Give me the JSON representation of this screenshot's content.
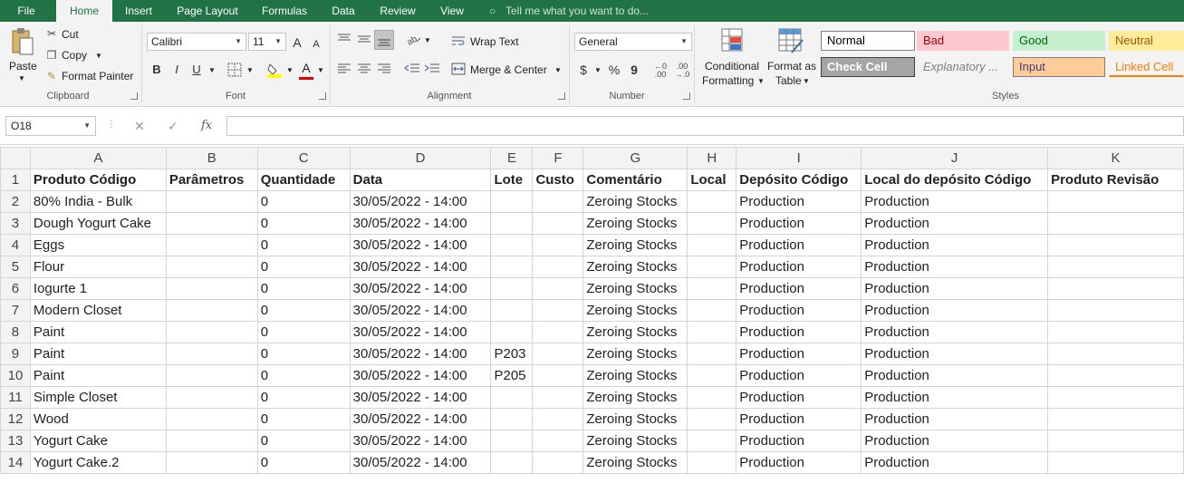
{
  "menu": {
    "tabs": [
      "File",
      "Home",
      "Insert",
      "Page Layout",
      "Formulas",
      "Data",
      "Review",
      "View"
    ],
    "active_tab": "Home",
    "tell_me": "Tell me what you want to do..."
  },
  "ribbon": {
    "clipboard": {
      "paste": "Paste",
      "cut": "Cut",
      "copy": "Copy",
      "format_painter": "Format Painter",
      "label": "Clipboard"
    },
    "font": {
      "name": "Calibri",
      "size": "11",
      "bold": "B",
      "italic": "I",
      "underline": "U",
      "grow": "A",
      "shrink": "A",
      "font_color": "A",
      "label": "Font"
    },
    "alignment": {
      "wrap_text": "Wrap Text",
      "merge_center": "Merge & Center",
      "label": "Alignment"
    },
    "number": {
      "format": "General",
      "currency": "$",
      "percent": "%",
      "comma": "9",
      "label": "Number"
    },
    "styles_buttons": {
      "conditional_line1": "Conditional",
      "conditional_line2": "Formatting",
      "format_table_line1": "Format as",
      "format_table_line2": "Table"
    },
    "styles": {
      "label": "Styles",
      "cells": [
        {
          "name": "Normal",
          "bg": "#ffffff",
          "color": "#000000",
          "border": "#7f7f7f"
        },
        {
          "name": "Bad",
          "bg": "#ffc7ce",
          "color": "#9c0006",
          "border": "#ffc7ce"
        },
        {
          "name": "Good",
          "bg": "#c6efce",
          "color": "#006100",
          "border": "#c6efce"
        },
        {
          "name": "Neutral",
          "bg": "#ffeb9c",
          "color": "#9c5700",
          "border": "#ffeb9c"
        },
        {
          "name": "Check Cell",
          "bg": "#a5a5a5",
          "color": "#ffffff",
          "border": "#3f3f3f"
        },
        {
          "name": "Explanatory ...",
          "bg": "#f3f3f3",
          "color": "#7f7f7f",
          "border": "#f3f3f3"
        },
        {
          "name": "Input",
          "bg": "#ffcc99",
          "color": "#3f3f76",
          "border": "#7f7f7f"
        },
        {
          "name": "Linked Cell",
          "bg": "#f3f3f3",
          "color": "#fa7d00",
          "border": "#f3f3f3"
        }
      ]
    }
  },
  "formula_bar": {
    "name_box": "O18",
    "fx": "fx",
    "cancel": "✕",
    "enter": "✓",
    "value": ""
  },
  "sheet": {
    "columns": [
      "A",
      "B",
      "C",
      "D",
      "E",
      "F",
      "G",
      "H",
      "I",
      "J",
      "K"
    ],
    "rows": [
      {
        "n": "1",
        "cells": [
          "Produto Código",
          "Parâmetros",
          "Quantidade",
          "Data",
          "Lote",
          "Custo",
          "Comentário",
          "Local",
          "Depósito Código",
          "Local do depósito Código",
          "Produto Revisão"
        ]
      },
      {
        "n": "2",
        "cells": [
          "80% India - Bulk",
          "",
          "0",
          "30/05/2022 - 14:00",
          "",
          "",
          "Zeroing Stocks",
          "",
          "Production",
          "Production",
          ""
        ]
      },
      {
        "n": "3",
        "cells": [
          "Dough Yogurt Cake",
          "",
          "0",
          "30/05/2022 - 14:00",
          "",
          "",
          "Zeroing Stocks",
          "",
          "Production",
          "Production",
          ""
        ]
      },
      {
        "n": "4",
        "cells": [
          "Eggs",
          "",
          "0",
          "30/05/2022 - 14:00",
          "",
          "",
          "Zeroing Stocks",
          "",
          "Production",
          "Production",
          ""
        ]
      },
      {
        "n": "5",
        "cells": [
          "Flour",
          "",
          "0",
          "30/05/2022 - 14:00",
          "",
          "",
          "Zeroing Stocks",
          "",
          "Production",
          "Production",
          ""
        ]
      },
      {
        "n": "6",
        "cells": [
          "Iogurte 1",
          "",
          "0",
          "30/05/2022 - 14:00",
          "",
          "",
          "Zeroing Stocks",
          "",
          "Production",
          "Production",
          ""
        ]
      },
      {
        "n": "7",
        "cells": [
          "Modern Closet",
          "",
          "0",
          "30/05/2022 - 14:00",
          "",
          "",
          "Zeroing Stocks",
          "",
          "Production",
          "Production",
          ""
        ]
      },
      {
        "n": "8",
        "cells": [
          "Paint",
          "",
          "0",
          "30/05/2022 - 14:00",
          "",
          "",
          "Zeroing Stocks",
          "",
          "Production",
          "Production",
          ""
        ]
      },
      {
        "n": "9",
        "cells": [
          "Paint",
          "",
          "0",
          "30/05/2022 - 14:00",
          "P203",
          "",
          "Zeroing Stocks",
          "",
          "Production",
          "Production",
          ""
        ]
      },
      {
        "n": "10",
        "cells": [
          "Paint",
          "",
          "0",
          "30/05/2022 - 14:00",
          "P205",
          "",
          "Zeroing Stocks",
          "",
          "Production",
          "Production",
          ""
        ]
      },
      {
        "n": "11",
        "cells": [
          "Simple Closet",
          "",
          "0",
          "30/05/2022 - 14:00",
          "",
          "",
          "Zeroing Stocks",
          "",
          "Production",
          "Production",
          ""
        ]
      },
      {
        "n": "12",
        "cells": [
          "Wood",
          "",
          "0",
          "30/05/2022 - 14:00",
          "",
          "",
          "Zeroing Stocks",
          "",
          "Production",
          "Production",
          ""
        ]
      },
      {
        "n": "13",
        "cells": [
          "Yogurt Cake",
          "",
          "0",
          "30/05/2022 - 14:00",
          "",
          "",
          "Zeroing Stocks",
          "",
          "Production",
          "Production",
          ""
        ]
      },
      {
        "n": "14",
        "cells": [
          "Yogurt Cake.2",
          "",
          "0",
          "30/05/2022 - 14:00",
          "",
          "",
          "Zeroing Stocks",
          "",
          "Production",
          "Production",
          ""
        ]
      }
    ]
  }
}
